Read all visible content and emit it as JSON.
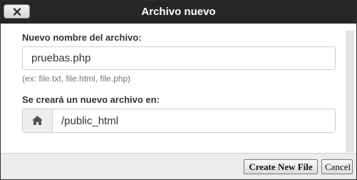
{
  "dialog": {
    "title": "Archivo nuevo",
    "close_icon": "close-icon"
  },
  "form": {
    "filename_label": "Nuevo nombre del archivo:",
    "filename_value": "pruebas.php",
    "hint": "(ex: file.txt, file.html, file.php)",
    "location_label": "Se creará un nuevo archivo en:",
    "location_icon": "home-icon",
    "location_value": "/public_html"
  },
  "footer": {
    "create_label": "Create New File",
    "cancel_label": "Cancel"
  }
}
